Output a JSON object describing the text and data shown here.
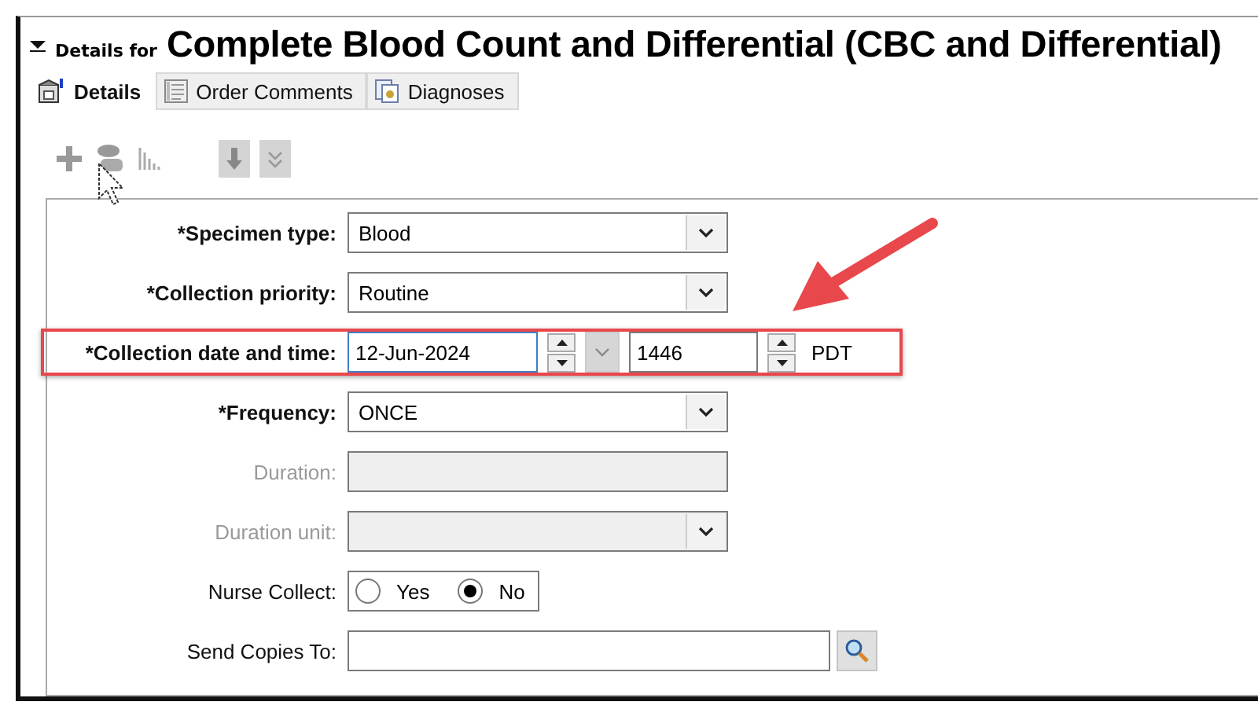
{
  "header": {
    "prefix": "Details for",
    "title": "Complete Blood Count and Differential (CBC and Differential)",
    "expanded": true
  },
  "tabs": [
    {
      "label": "Details",
      "selected": true
    },
    {
      "label": "Order Comments",
      "selected": false
    },
    {
      "label": "Diagnoses",
      "selected": false
    }
  ],
  "fields": [
    {
      "kind": "select",
      "label": "*Specimen type:",
      "value": "Blood",
      "required": true,
      "disabled": false
    },
    {
      "kind": "select",
      "label": "*Collection priority:",
      "value": "Routine",
      "required": true,
      "disabled": false
    },
    {
      "kind": "datetime",
      "label": "*Collection date and time:",
      "date": "12-Jun-2024",
      "time": "1446",
      "zone": "PDT",
      "required": true,
      "disabled": false,
      "highlighted": true
    },
    {
      "kind": "select",
      "label": "*Frequency:",
      "value": "ONCE",
      "required": true,
      "disabled": false
    },
    {
      "kind": "text",
      "label": "Duration:",
      "required": false,
      "disabled": true
    },
    {
      "kind": "select",
      "label": "Duration unit:",
      "required": false,
      "disabled": true
    },
    {
      "kind": "radio",
      "label": "Nurse Collect:",
      "required": false,
      "disabled": false,
      "options": [
        {
          "label": "Yes",
          "selected": false
        },
        {
          "label": "No",
          "selected": true
        }
      ]
    },
    {
      "kind": "lookup",
      "label": "Send Copies To:",
      "required": false,
      "disabled": false
    }
  ]
}
